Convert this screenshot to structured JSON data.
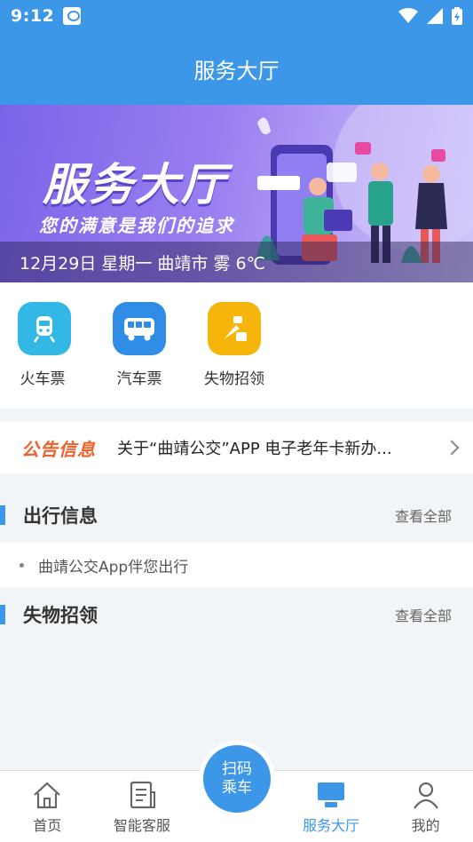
{
  "status_bar": {
    "time": "9:12"
  },
  "header": {
    "title": "服务大厅"
  },
  "banner": {
    "title": "服务大厅",
    "slogan": "您的满意是我们的追求",
    "info": "12月29日 星期一 曲靖市 雾 6℃"
  },
  "quick_links": [
    {
      "label": "火车票",
      "icon": "train-icon",
      "color": "#33b8e6"
    },
    {
      "label": "汽车票",
      "icon": "bus-icon",
      "color": "#2f8de6"
    },
    {
      "label": "失物招领",
      "icon": "lost-found-icon",
      "color": "#f5b50a"
    }
  ],
  "notice": {
    "tag": "公告信息",
    "text": "关于“曲靖公交”APP 电子老年卡新办..."
  },
  "travel_info": {
    "title": "出行信息",
    "more": "查看全部",
    "items": [
      "曲靖公交App伴您出行"
    ]
  },
  "lost_found": {
    "title": "失物招领",
    "more": "查看全部"
  },
  "bottom_nav": {
    "home": "首页",
    "service": "智能客服",
    "scan_line1": "扫码",
    "scan_line2": "乘车",
    "hall": "服务大厅",
    "mine": "我的"
  },
  "colors": {
    "primary": "#3d97e8",
    "notice_tag": "#f0602a"
  }
}
